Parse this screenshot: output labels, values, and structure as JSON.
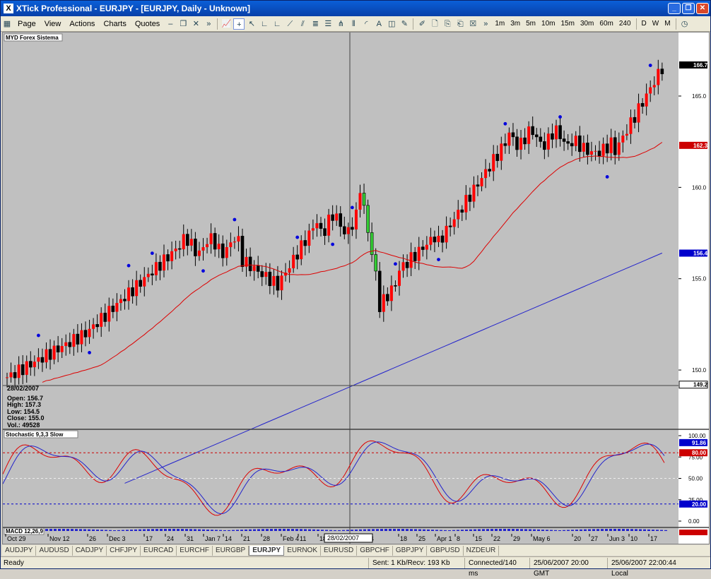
{
  "window": {
    "app_icon": "X",
    "title": "XTick Professional - EURJPY - [EURJPY, Daily - Unknown]"
  },
  "menu": {
    "items": [
      "Page",
      "View",
      "Actions",
      "Charts",
      "Quotes"
    ],
    "timeframes": [
      "1m",
      "3m",
      "5m",
      "10m",
      "15m",
      "30m",
      "60m",
      "240",
      "D",
      "W",
      "M"
    ]
  },
  "chart": {
    "title": "MYD Forex Sistema",
    "crosshair_date": "28/02/2007",
    "info": {
      "date": "28/02/2007",
      "open": "Open: 156.7",
      "high": "High: 157.3",
      "low": "Low: 154.5",
      "close": "Close: 155.0",
      "vol": "Vol.: 49528"
    },
    "price_ticks": [
      "165.0",
      "160.0",
      "155.0",
      "150.0"
    ],
    "price_tags": [
      {
        "label": "166.7",
        "color": "#000000",
        "value": 166.7
      },
      {
        "label": "162.3",
        "color": "#cc0000",
        "value": 162.3
      },
      {
        "label": "156.4",
        "color": "#0000cc",
        "value": 156.4
      },
      {
        "label": "149.2",
        "color": "#ffffff",
        "value": 149.2
      }
    ],
    "date_ticks": [
      "Oct 29",
      "Nov 12",
      "26",
      "Dec 3",
      "17",
      "24",
      "31",
      "Jan 7",
      "14",
      "21",
      "28",
      "Feb 4",
      "11",
      "18",
      "4",
      "18",
      "25",
      "Apr 1",
      "8",
      "15",
      "22",
      "29",
      "May 6",
      "20",
      "27",
      "Jun 3",
      "10",
      "17"
    ],
    "colors": {
      "up": "#ff0000",
      "down": "#000000",
      "highlight": "#33cc33",
      "ma_fast": "#dd0000",
      "ma_slow": "#2222cc",
      "marker": "#0000dd"
    }
  },
  "stochastic": {
    "title": "Stochastic 9,3,3 Slow",
    "axis_ticks": [
      "100.00",
      "75.00",
      "50.00",
      "25.00",
      "0.00"
    ],
    "tags": [
      {
        "label": "91.86",
        "color": "#0000cc",
        "value": 91.86
      },
      {
        "label": "80.00",
        "color": "#cc0000",
        "value": 80
      },
      {
        "label": "20.00",
        "color": "#0000cc",
        "value": 20
      }
    ]
  },
  "macd": {
    "title": "MACD 12,26,9"
  },
  "symbols": [
    "AUDJPY",
    "AUDUSD",
    "CADJPY",
    "CHFJPY",
    "EURCAD",
    "EURCHF",
    "EURGBP",
    "EURJPY",
    "EURNOK",
    "EURUSD",
    "GBPCHF",
    "GBPJPY",
    "GBPUSD",
    "NZDEUR"
  ],
  "active_symbol": "EURJPY",
  "status": {
    "ready": "Ready",
    "traffic": "Sent: 1 Kb/Recv: 193 Kb",
    "connection": "Connected/140 ms",
    "gmt": "25/06/2007 20:00 GMT",
    "local": "25/06/2007 22:00:44 Local"
  }
}
